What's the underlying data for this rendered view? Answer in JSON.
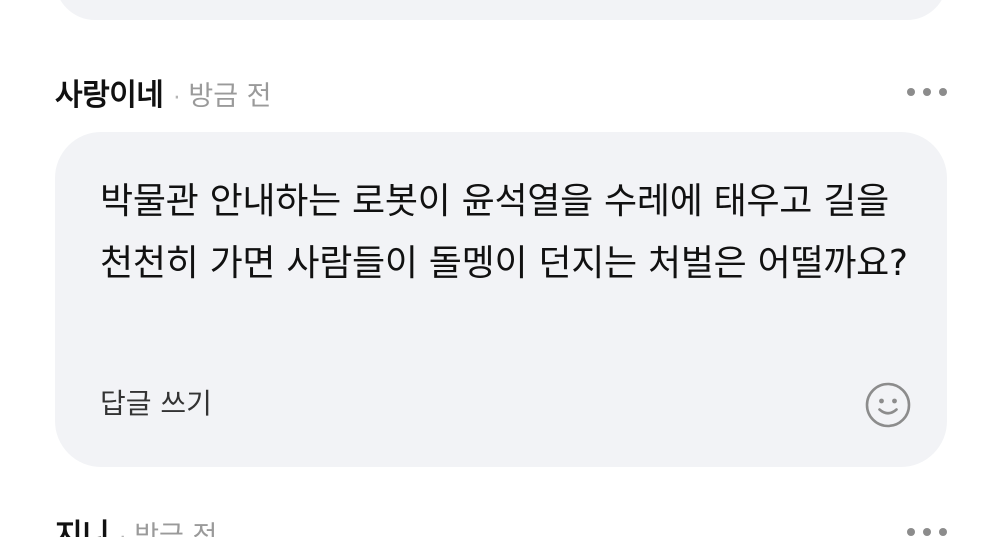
{
  "comments": [
    {
      "author": "사랑이네",
      "separator": "·",
      "time": "방금 전",
      "text": "박물관 안내하는 로봇이 윤석열을 수레에 태우고 길을 천천히 가면 사람들이 돌멩이 던지는 처벌은 어떨까요?",
      "reply_label": "답글 쓰기"
    },
    {
      "author": "지니",
      "separator": "·",
      "time": "방금 전"
    }
  ],
  "icons": {
    "more": "more-dots-icon",
    "emoji": "smiley-face-icon"
  },
  "colors": {
    "bubble_bg": "#f2f3f6",
    "author": "#111111",
    "meta": "#9a9a9a"
  }
}
